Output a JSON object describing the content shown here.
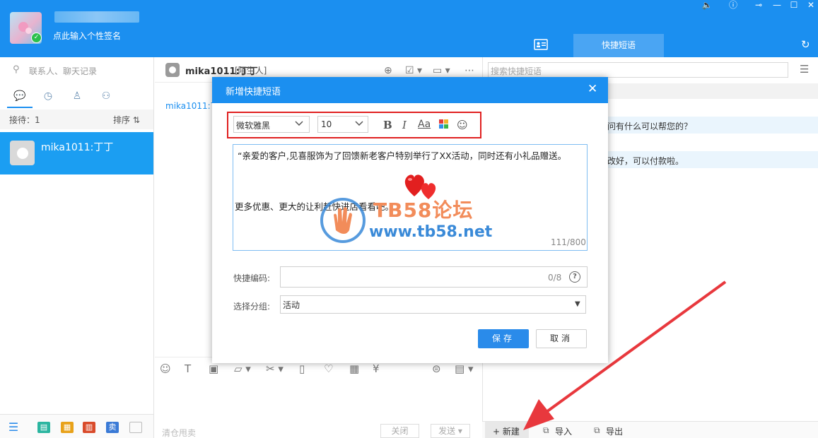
{
  "header": {
    "signature": "点此输入个性签名",
    "quick_tab": "快捷短语"
  },
  "left": {
    "search_placeholder": "联系人、聊天记录",
    "reception": "接待：1",
    "sort": "排序 ⇅",
    "contact_name": "mika1011:丁丁"
  },
  "chat": {
    "title": "mika1011:丁丁",
    "tag": "[陌生人]",
    "msg_name": "mika1011:丁",
    "clear_hint": "清仓甩卖",
    "close": "关闭",
    "send": "发送 ▾"
  },
  "right": {
    "search_placeholder": "搜索快捷短语",
    "phrase1": "问有什么可以帮您的？",
    "phrase2": "改好，可以付款啦。",
    "new": "+ 新建",
    "import": "导入",
    "export": "导出"
  },
  "dialog": {
    "title": "新增快捷短语",
    "font": "微软雅黑",
    "size": "10",
    "content_line1": "“亲爱的客户,见喜服饰为了回馈新老客户特别举行了XX活动，同时还有小礼品赠送。",
    "content_line2": "更多优惠、更大的让利赶快进店看看吧。",
    "content_count": "111/800",
    "code_label": "快捷编码:",
    "code_count": "0/8",
    "group_label": "选择分组:",
    "group_value": "活动",
    "save": "保存",
    "cancel": "取消"
  },
  "watermark": {
    "text1": "TB58论坛",
    "text2": "www.tb58.net"
  },
  "colors": {
    "primary": "#1b8ff0",
    "highlight": "#e02020",
    "arrow": "#e8383d"
  }
}
